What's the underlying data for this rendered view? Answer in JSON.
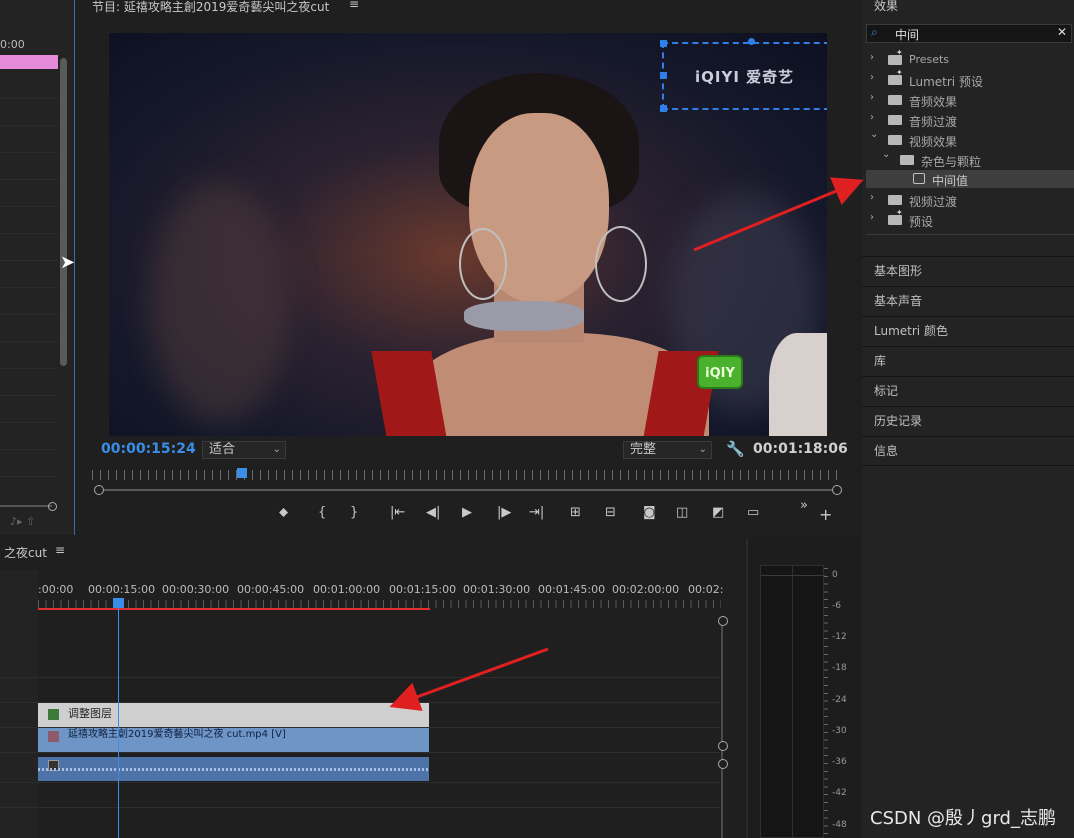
{
  "left_panel": {
    "timecode": "0:00",
    "footer_icons": "♪▸  ⇧"
  },
  "program_monitor": {
    "title": "节目: 延禧攻略主創2019爱奇藝尖叫之夜cut",
    "menu": "≡",
    "logo_text": "iQIYI 爱奇艺",
    "green_logo": "iQIY",
    "current_timecode": "00:00:15:24",
    "fit_value": "适合",
    "quality_value": "完整",
    "duration": "00:01:18:06",
    "transport": {
      "add_marker": "⬥",
      "mark_in": "{",
      "mark_out": "}",
      "go_to_in": "|⇤",
      "step_back": "◀|",
      "play": "▶",
      "step_forward": "|▶",
      "go_to_out": "⇥|",
      "lift": "⊞",
      "extract": "⊟",
      "export_frame": "◙",
      "compare": "◫",
      "vr": "◩",
      "safe_margins": "▭",
      "more": "»",
      "add": "+"
    }
  },
  "timeline": {
    "title": "之夜cut",
    "menu": "≡",
    "time_labels": [
      ":00:00",
      "00:00:15:00",
      "00:00:30:00",
      "00:00:45:00",
      "00:01:00:00",
      "00:01:15:00",
      "00:01:30:00",
      "00:01:45:00",
      "00:02:00:00",
      "00:02:"
    ],
    "clips": {
      "adjustment_layer": "调整图层",
      "video": "延禧攻略主創2019爱奇藝尖叫之夜 cut.mp4 [V]"
    }
  },
  "audio_meter": {
    "db_labels": [
      "0",
      "-6",
      "-12",
      "-18",
      "-24",
      "-30",
      "-36",
      "-42",
      "-48"
    ]
  },
  "effects_panel": {
    "title": "效果",
    "search_value": "中间",
    "search_icon": "search-icon",
    "clear": "✕",
    "tree": [
      {
        "label": "Presets",
        "chevron": "›",
        "icon": "folder-star"
      },
      {
        "label": "Lumetri 预设",
        "chevron": "›",
        "icon": "folder-star"
      },
      {
        "label": "音频效果",
        "chevron": "›",
        "icon": "folder"
      },
      {
        "label": "音频过渡",
        "chevron": "›",
        "icon": "folder"
      },
      {
        "label": "视频效果",
        "chevron": "⌄",
        "icon": "folder"
      },
      {
        "label": "杂色与颗粒",
        "chevron": "⌄",
        "icon": "folder"
      },
      {
        "label": "中间值",
        "chevron": "",
        "icon": "effect"
      },
      {
        "label": "视频过渡",
        "chevron": "›",
        "icon": "folder"
      },
      {
        "label": "预设",
        "chevron": "›",
        "icon": "folder-star"
      }
    ],
    "sections": [
      "基本图形",
      "基本声音",
      "Lumetri 颜色",
      "库",
      "标记",
      "历史记录",
      "信息"
    ]
  },
  "watermark": "CSDN @殷丿grd_志鹏",
  "colors": {
    "accent_blue": "#3a8de8",
    "annotation_red": "#e02020",
    "adjustment_clip": "#cfcfcf",
    "video_clip": "#6e95c6",
    "audio_clip": "#4d73a8",
    "in_out_bar": "#e03030"
  }
}
